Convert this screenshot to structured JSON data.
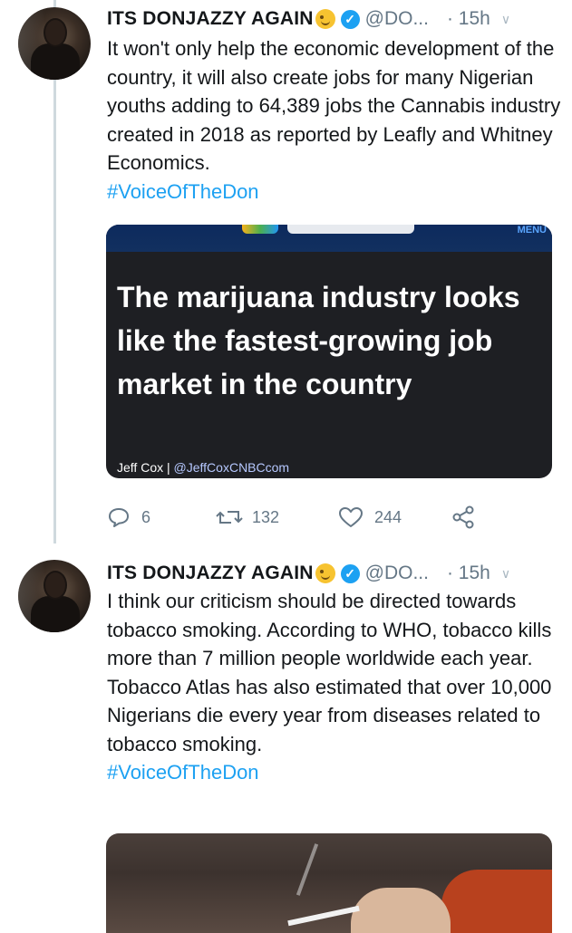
{
  "tweets": [
    {
      "author_name": "ITS DONJAZZY AGAIN",
      "handle": "@DO...",
      "time": "· 15h",
      "text": "It won't only help the economic development of the country, it will also create jobs for many Nigerian youths adding to 64,389 jobs the Cannabis industry created in 2018 as reported by Leafly and Whitney Economics.",
      "hashtag": "#VoiceOfTheDon",
      "card": {
        "menu_label": "MENU",
        "headline": "The marijuana industry looks like the fastest-growing job market in the country",
        "byline_author": "Jeff Cox",
        "byline_sep": "|",
        "byline_handle": "@JeffCoxCNBCcom"
      },
      "actions": {
        "replies": "6",
        "retweets": "132",
        "likes": "244"
      }
    },
    {
      "author_name": "ITS DONJAZZY AGAIN",
      "handle": "@DO...",
      "time": "· 15h",
      "text": "I think our criticism should be directed towards tobacco smoking. According to WHO, tobacco kills more than 7 million people worldwide each year. Tobacco Atlas has also estimated that over 10,000 Nigerians die every year from diseases related to tobacco smoking.",
      "hashtag": "#VoiceOfTheDon"
    }
  ],
  "icons": {
    "verified": "verified-badge-icon",
    "emoji": "winking-face-emoji",
    "caret": "chevron-down-icon",
    "reply": "reply-icon",
    "retweet": "retweet-icon",
    "like": "heart-icon",
    "share": "share-icon"
  },
  "colors": {
    "link": "#1da1f2",
    "verified": "#1da1f2",
    "muted": "#657786",
    "card_background": "#1e1f23"
  }
}
